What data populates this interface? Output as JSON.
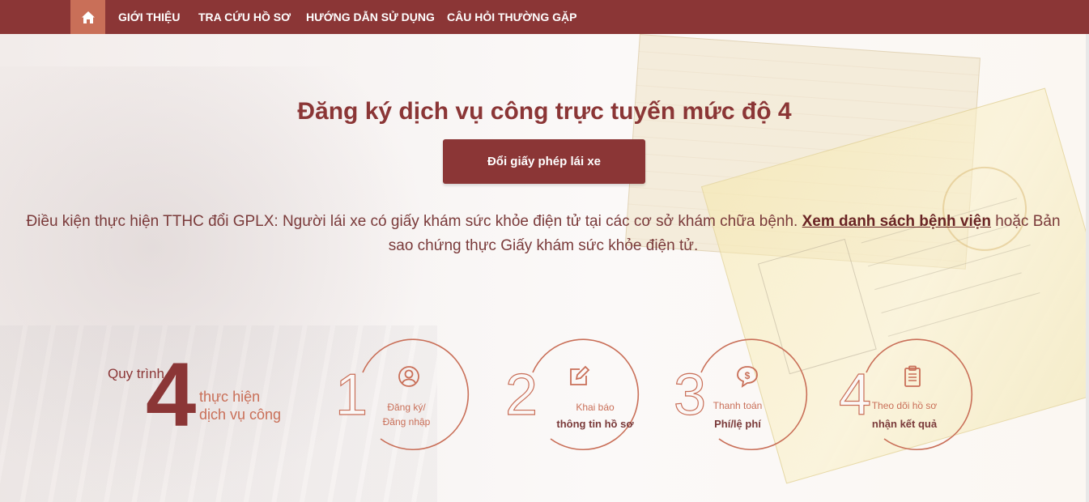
{
  "nav": {
    "items": [
      {
        "label": "GIỚI THIỆU"
      },
      {
        "label": "TRA CỨU HỒ SƠ"
      },
      {
        "label": "HƯỚNG DẪN SỬ DỤNG"
      },
      {
        "label": "CÂU HỎI THƯỜNG GẶP"
      }
    ]
  },
  "main": {
    "title": "Đăng ký dịch vụ công trực tuyến mức độ 4",
    "button_label": "Đổi giấy phép lái xe",
    "condition_text_1": "Điều kiện thực hiện TTHC đổi GPLX: Người lái xe có giấy khám sức khỏe điện tử tại các cơ sở khám chữa bệnh.",
    "condition_link": "Xem danh sách bệnh viện",
    "condition_text_2": "hoặc Bản sao chứng thực Giấy khám sức khỏe điện tử."
  },
  "process": {
    "label": "Quy trình",
    "count": "4",
    "sub_line1": "thực hiện",
    "sub_line2": "dịch vụ công",
    "steps": [
      {
        "number": "1",
        "line1": "Đăng ký/",
        "line2": "Đăng nhập",
        "icon": "user-icon"
      },
      {
        "number": "2",
        "line1": "Khai báo",
        "line2": "thông tin hồ sơ",
        "icon": "edit-icon"
      },
      {
        "number": "3",
        "line1": "Thanh toán",
        "line2": "Phí/lệ phí",
        "icon": "dollar-icon"
      },
      {
        "number": "4",
        "line1": "Theo dõi hồ sơ",
        "line2": "nhận kết quả",
        "icon": "clipboard-icon"
      }
    ]
  },
  "colors": {
    "brand": "#8b3636",
    "accent": "#c96f58",
    "home_bg": "#c96f58"
  }
}
